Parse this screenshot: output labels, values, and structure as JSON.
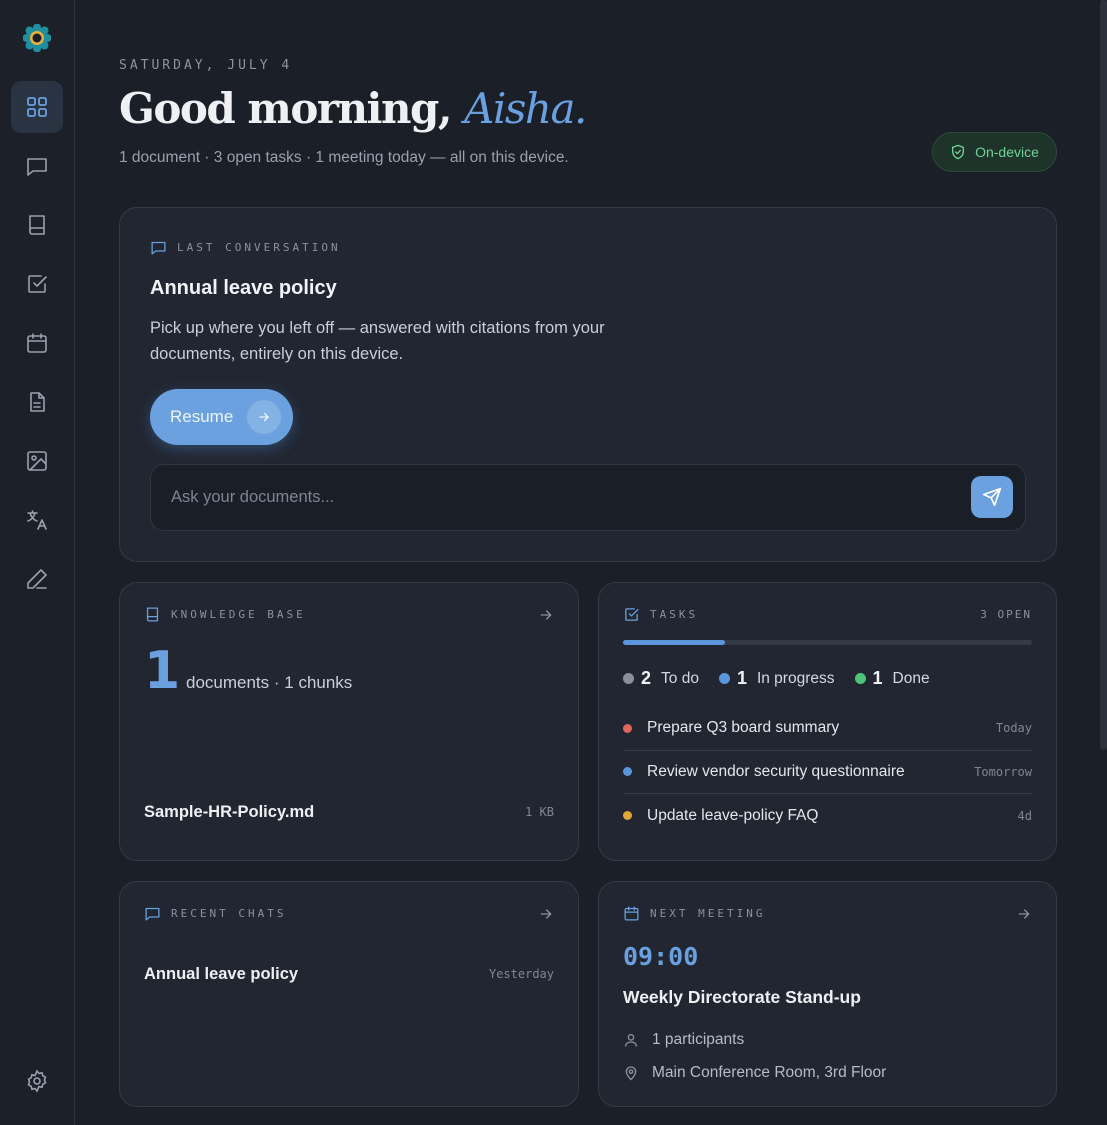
{
  "sidebar": {
    "logo_icon": "flower-logo-icon",
    "items": [
      {
        "icon": "grid-icon",
        "label": "Dashboard",
        "active": true
      },
      {
        "icon": "chat-icon",
        "label": "Chat"
      },
      {
        "icon": "book-icon",
        "label": "Knowledge base"
      },
      {
        "icon": "checkbox-icon",
        "label": "Tasks"
      },
      {
        "icon": "calendar-icon",
        "label": "Calendar"
      },
      {
        "icon": "document-icon",
        "label": "Documents"
      },
      {
        "icon": "image-icon",
        "label": "Images"
      },
      {
        "icon": "translate-icon",
        "label": "Translate"
      },
      {
        "icon": "pen-icon",
        "label": "Write"
      }
    ],
    "settings_icon": "gear-icon"
  },
  "header": {
    "date": "SATURDAY, JULY 4",
    "greeting": "Good morning,",
    "name": "Aisha.",
    "summary": "1 document · 3 open tasks · 1 meeting today — all on this device.",
    "badge": "On-device"
  },
  "last_conversation": {
    "eyebrow": "LAST CONVERSATION",
    "title": "Annual leave policy",
    "description": "Pick up where you left off — answered with citations from your documents, entirely on this device.",
    "resume_label": "Resume",
    "ask_placeholder": "Ask your documents..."
  },
  "knowledge_base": {
    "eyebrow": "KNOWLEDGE BASE",
    "count": "1",
    "label": "documents · 1 chunks",
    "file_name": "Sample-HR-Policy.md",
    "file_size": "1 KB"
  },
  "tasks": {
    "eyebrow": "TASKS",
    "open_count": "3 OPEN",
    "progress": 0.25,
    "statuses": [
      {
        "count": "2",
        "label": "To do",
        "color": "#8a8f99"
      },
      {
        "count": "1",
        "label": "In progress",
        "color": "#5b96dd"
      },
      {
        "count": "1",
        "label": "Done",
        "color": "#4fc27a"
      }
    ],
    "items": [
      {
        "title": "Prepare Q3 board summary",
        "due": "Today",
        "color": "#e0665c"
      },
      {
        "title": "Review vendor security questionnaire",
        "due": "Tomorrow",
        "color": "#5b96dd"
      },
      {
        "title": "Update leave-policy FAQ",
        "due": "4d",
        "color": "#e0a63c"
      }
    ]
  },
  "recent_chats": {
    "eyebrow": "RECENT CHATS",
    "items": [
      {
        "title": "Annual leave policy",
        "time": "Yesterday"
      }
    ]
  },
  "next_meeting": {
    "eyebrow": "NEXT MEETING",
    "time": "09:00",
    "title": "Weekly Directorate Stand-up",
    "participants": "1 participants",
    "location": "Main Conference Room, 3rd Floor"
  }
}
